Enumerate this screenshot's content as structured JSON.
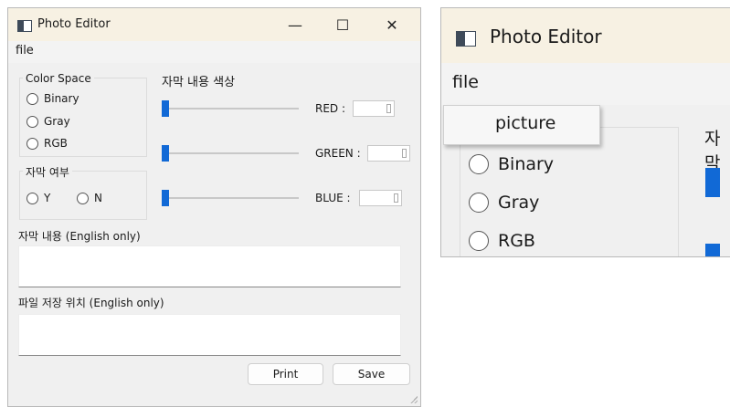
{
  "window": {
    "title": "Photo Editor",
    "controls": {
      "minimize": "—",
      "maximize": "☐",
      "close": "✕"
    }
  },
  "menu": {
    "file": "file",
    "items": [
      "picture"
    ]
  },
  "color_space": {
    "title": "Color Space",
    "options": [
      "Binary",
      "Gray",
      "RGB"
    ]
  },
  "subtitle_toggle": {
    "title": "자막 여부",
    "options": [
      "Y",
      "N"
    ]
  },
  "subtitle_color": {
    "title": "자막 내용 색상",
    "channels": [
      {
        "label": "RED :",
        "value": ""
      },
      {
        "label": "GREEN :",
        "value": ""
      },
      {
        "label": "BLUE :",
        "value": ""
      }
    ]
  },
  "subtitle_content": {
    "label": "자막 내용 (English only)",
    "value": ""
  },
  "save_path": {
    "label": "파일 저장 위치 (English only)",
    "value": ""
  },
  "buttons": {
    "print": "Print",
    "save": "Save"
  },
  "zoom": {
    "clipped_label": "자막"
  },
  "colors": {
    "accent": "#1169d6",
    "titlebar": "#f7f1e3",
    "window_bg": "#f0f0f0"
  }
}
